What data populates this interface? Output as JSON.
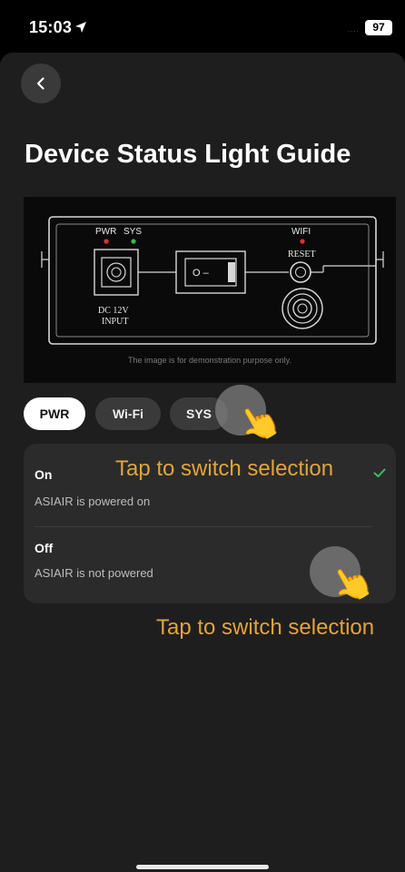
{
  "status_bar": {
    "time": "15:03",
    "signal": "....",
    "battery": "97"
  },
  "header": {
    "title": "Device Status Light Guide"
  },
  "device_image": {
    "pwr_label": "PWR",
    "sys_label": "SYS",
    "wifi_label": "WIFI",
    "reset_label": "RESET",
    "dc_label_line1": "DC 12V",
    "dc_label_line2": "INPUT",
    "switch_label": "O –",
    "note": "The image is for demonstration purpose only."
  },
  "tabs": [
    {
      "label": "PWR",
      "selected": true
    },
    {
      "label": "Wi-Fi",
      "selected": false
    },
    {
      "label": "SYS",
      "selected": false
    }
  ],
  "states": [
    {
      "name": "On",
      "description": "ASIAIR is powered on",
      "checked": true
    },
    {
      "name": "Off",
      "description": "ASIAIR is not powered",
      "checked": false
    }
  ],
  "hints": {
    "first": "Tap to switch selection",
    "second": "Tap to switch selection"
  },
  "colors": {
    "accent": "#e2a43a",
    "check": "#3cbf5a",
    "led_red": "#e03030",
    "led_green": "#2fbf4a"
  },
  "icons": {
    "back": "chevron-left-icon",
    "check": "checkmark-icon",
    "hand": "pointing-hand-icon"
  }
}
